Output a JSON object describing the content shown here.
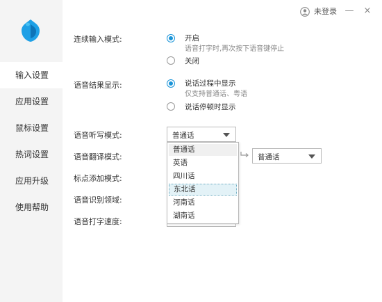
{
  "user": {
    "label": "未登录",
    "icon": "user-circle-icon"
  },
  "window": {
    "minimize": "—",
    "close": "×"
  },
  "sidebar": {
    "items": [
      {
        "label": "输入设置",
        "active": true
      },
      {
        "label": "应用设置",
        "active": false
      },
      {
        "label": "鼠标设置",
        "active": false
      },
      {
        "label": "热词设置",
        "active": false
      },
      {
        "label": "应用升级",
        "active": false
      },
      {
        "label": "使用帮助",
        "active": false
      }
    ]
  },
  "settings": {
    "continuous_input": {
      "label": "连续输入模式:",
      "on_label": "开启",
      "on_desc": "语音打字时,再次按下语音键停止",
      "off_label": "关闭",
      "selected": "on"
    },
    "result_display": {
      "label": "语音结果显示:",
      "opt1_label": "说话过程中显示",
      "opt1_desc": "仅支持普通话、粤语",
      "opt2_label": "说话停顿时显示",
      "selected": "opt1"
    },
    "dictation_mode": {
      "label": "语音听写模式:",
      "value": "普通话",
      "options": [
        "普通话",
        "英语",
        "四川话",
        "东北话",
        "河南话",
        "湖南话"
      ],
      "hovered": "东北话"
    },
    "translate_mode": {
      "label": "语音翻译模式:",
      "target_value": "普通话"
    },
    "punctuation_mode": {
      "label": "标点添加模式:"
    },
    "recognition_domain": {
      "label": "语音识别领域:"
    },
    "typing_speed": {
      "label": "语音打字速度:"
    }
  },
  "colors": {
    "accent": "#1a94d8",
    "sidebar_bg": "#f4f4f4",
    "hover_bg": "#e3f2f7"
  }
}
